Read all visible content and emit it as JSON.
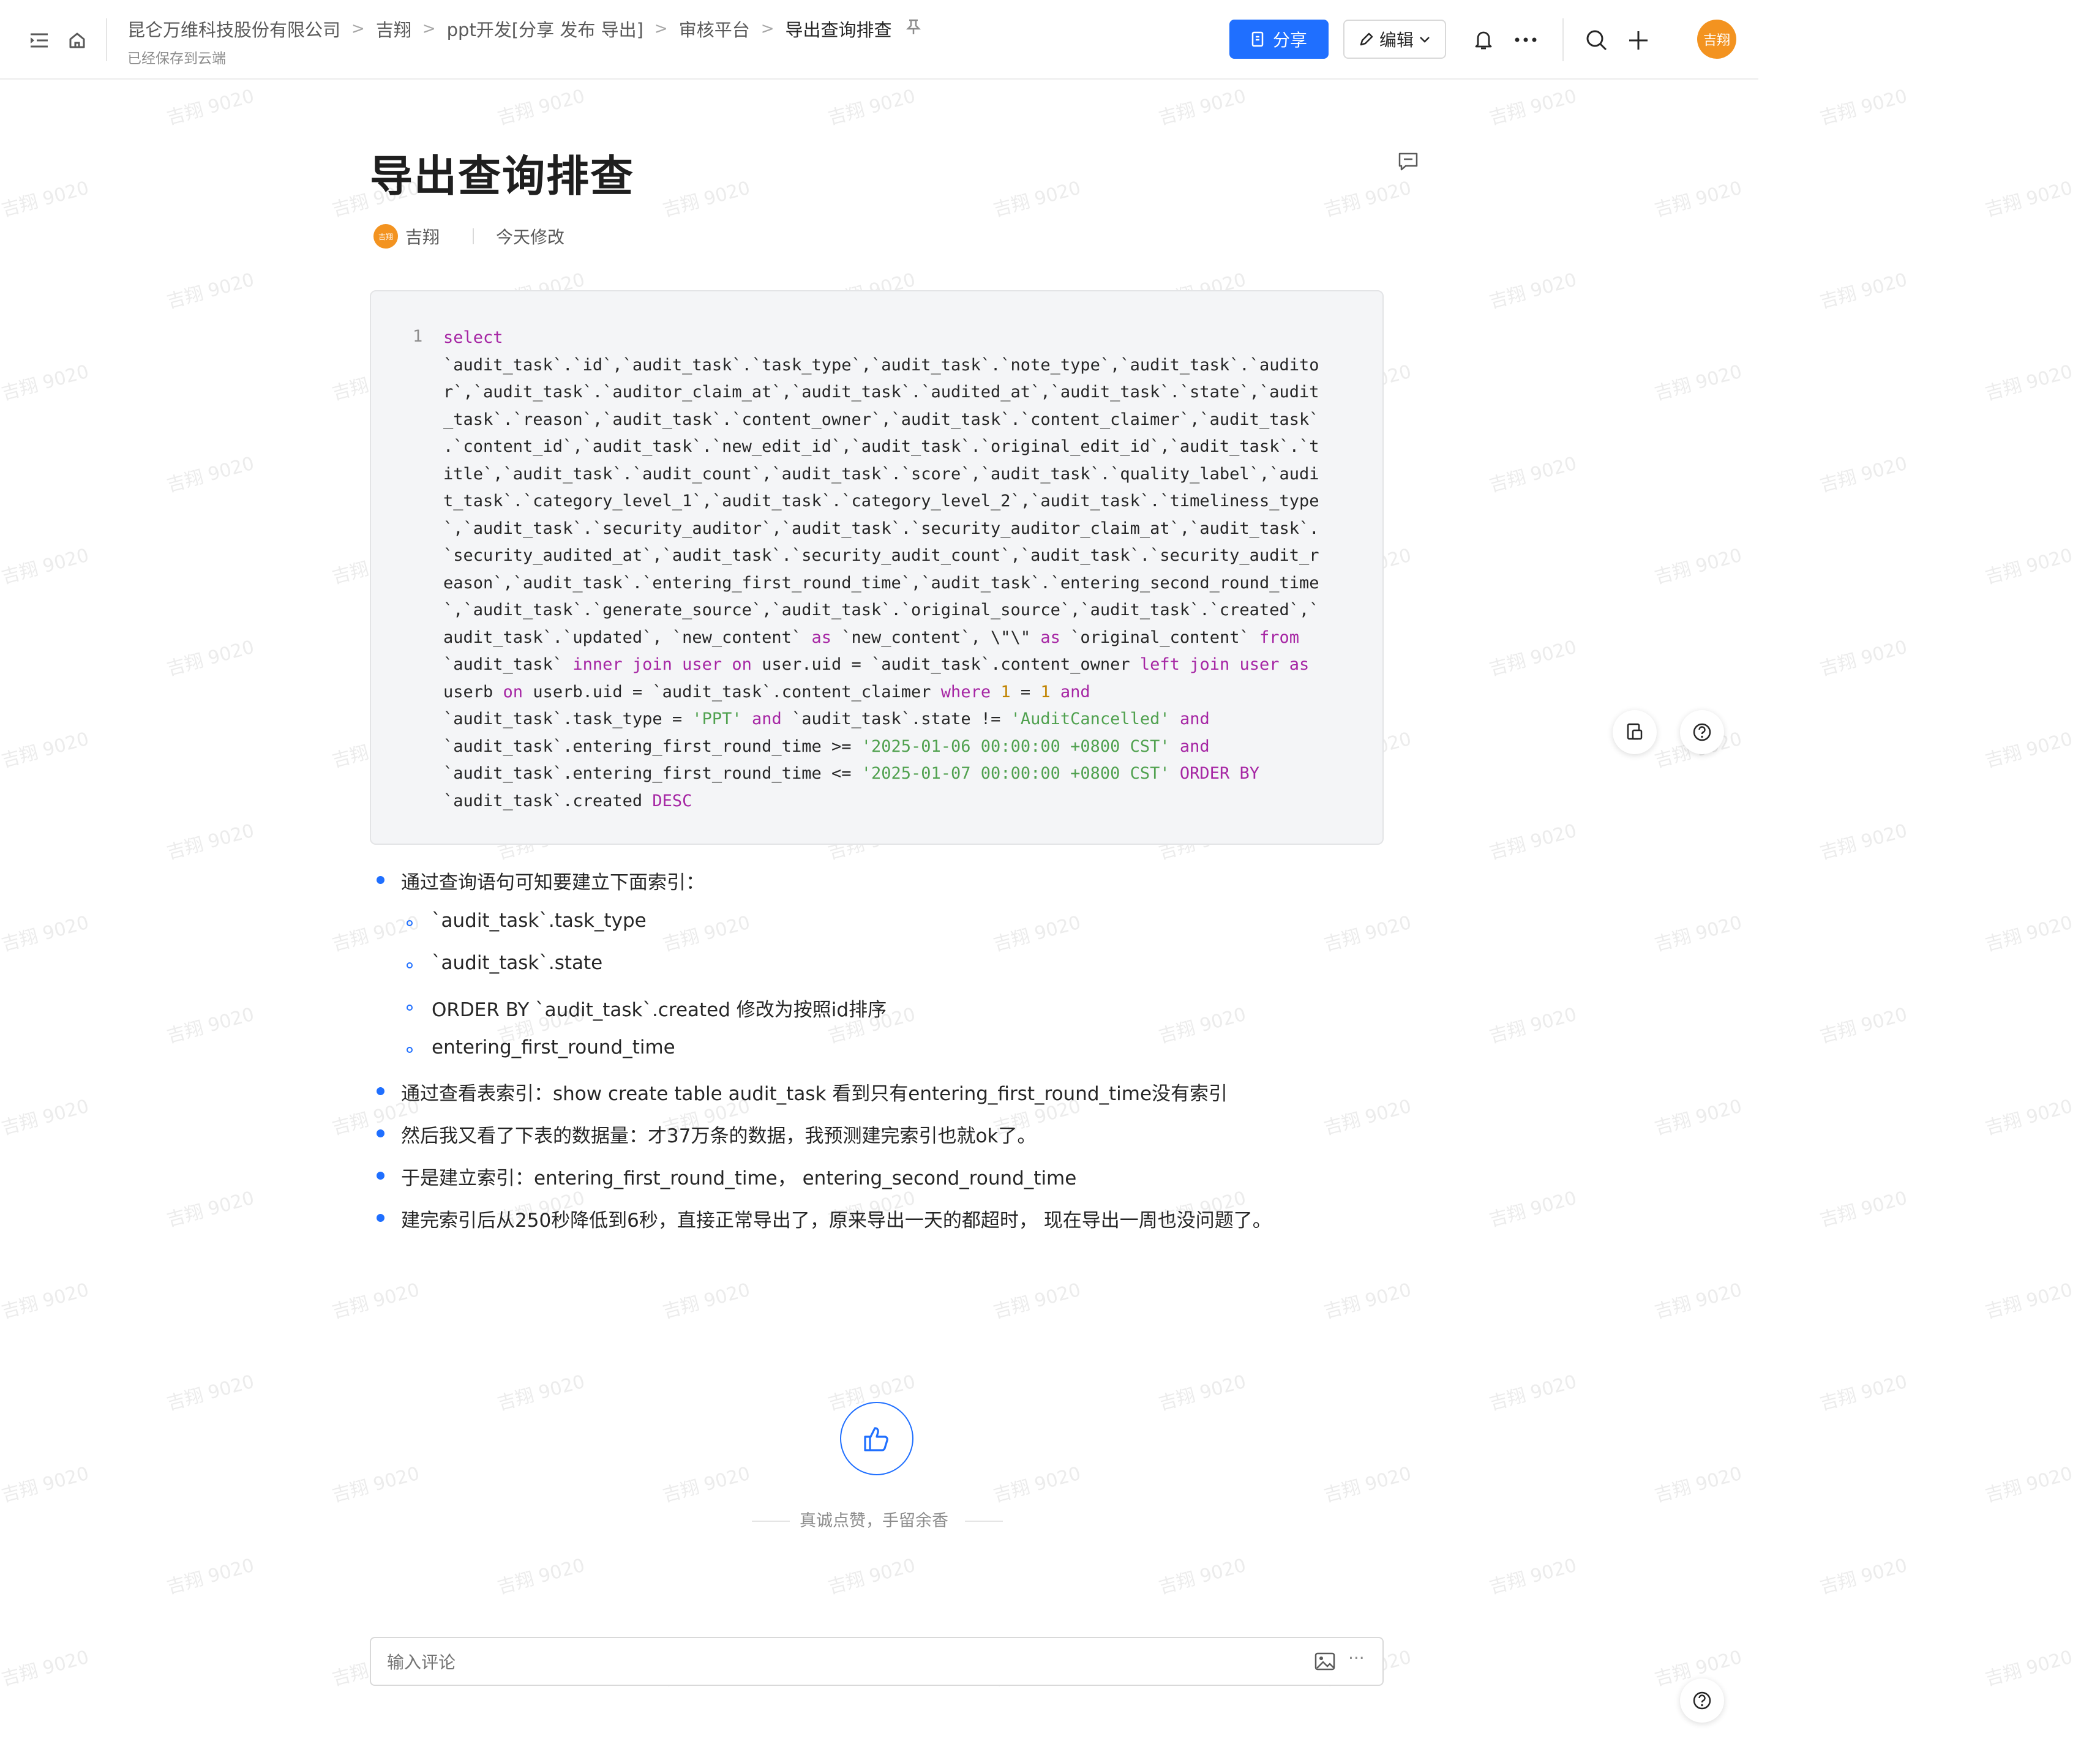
{
  "header": {
    "breadcrumb": [
      "昆仑万维科技股份有限公司",
      "吉翔",
      "ppt开发[分享 发布 导出]",
      "审核平台",
      "导出查询排查"
    ],
    "separator": ">",
    "save_status": "已经保存到云端",
    "share_label": "分享",
    "edit_label": "编辑",
    "user_avatar": "吉翔"
  },
  "doc": {
    "title": "导出查询排查",
    "author_avatar": "吉翔",
    "author": "吉翔",
    "modified": "今天修改"
  },
  "code": {
    "line_number": "1"
  },
  "bullets": [
    "通过查询语句可知要建立下面索引：",
    "通过查看表索引：show create table audit_task 看到只有entering_first_round_time没有索引",
    "然后我又看了下表的数据量：才37万条的数据，我预测建完索引也就ok了。",
    "于是建立索引：entering_first_round_time， entering_second_round_time",
    "建完索引后从250秒降低到6秒，直接正常导出了，原来导出一天的都超时， 现在导出一周也没问题了。"
  ],
  "sub_bullets": [
    "`audit_task`.task_type",
    "`audit_task`.state",
    "ORDER BY `audit_task`.created 修改为按照id排序",
    "entering_first_round_time"
  ],
  "like": {
    "caption": "真诚点赞，手留余香"
  },
  "comment": {
    "placeholder": "输入评论",
    "more": "···"
  },
  "watermark": "吉翔 9020",
  "colors": {
    "accent": "#1f6fff",
    "avatar": "#f39320",
    "code_bg": "#f4f5f7",
    "keyword": "#a626a4",
    "string": "#50a14f",
    "number": "#c18401"
  }
}
